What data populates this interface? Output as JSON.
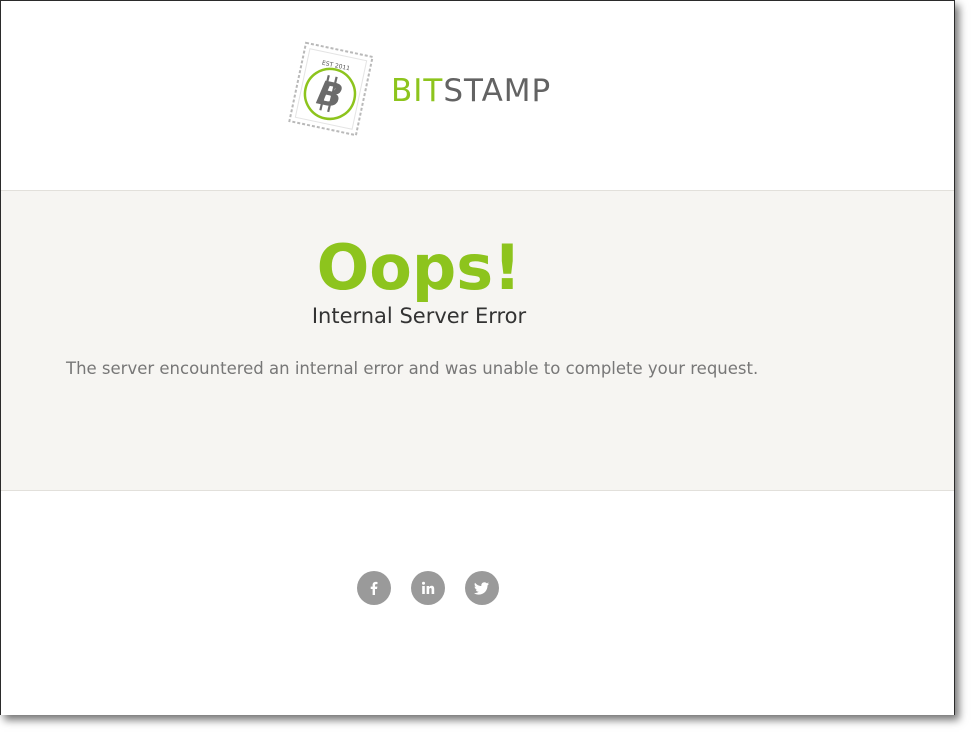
{
  "brand": {
    "part1": "BIT",
    "part2": "STAMP",
    "stamp_text": "EST 2011",
    "accent_color": "#8dc41d",
    "text_color": "#636363"
  },
  "error": {
    "headline": "Oops!",
    "title": "Internal Server Error",
    "message": "The server encountered an internal error and was unable to complete your request."
  },
  "social": [
    {
      "name": "facebook",
      "icon": "facebook-icon",
      "glyph": "f"
    },
    {
      "name": "linkedin",
      "icon": "linkedin-icon",
      "glyph": "in"
    },
    {
      "name": "twitter",
      "icon": "twitter-icon",
      "glyph": "bird"
    }
  ],
  "colors": {
    "band_background": "#f6f5f2",
    "icon_background": "#9a9a9a"
  }
}
